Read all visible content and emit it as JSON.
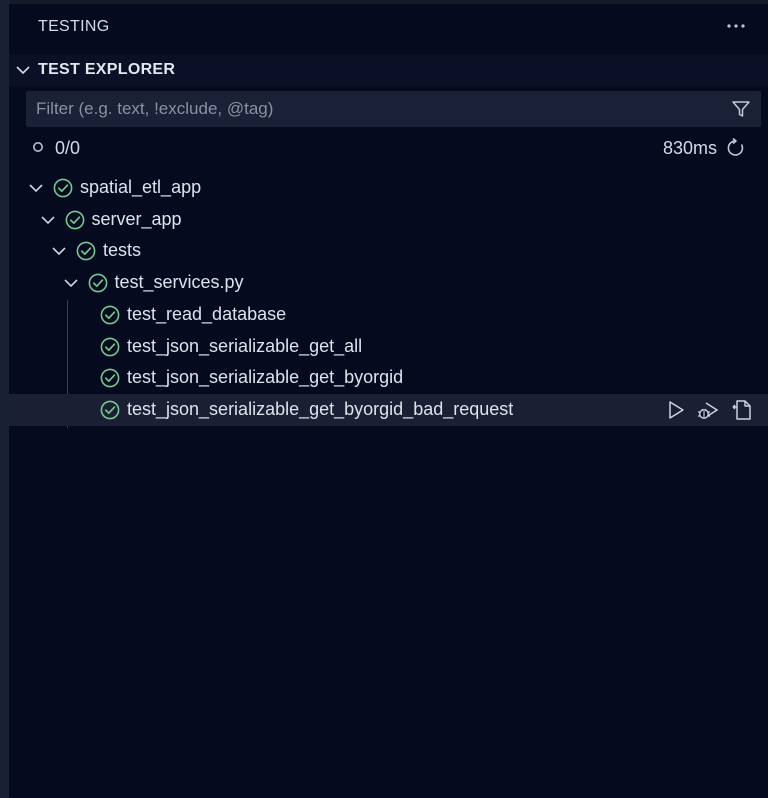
{
  "panel": {
    "title": "TESTING",
    "more_icon": "ellipsis-icon"
  },
  "section": {
    "title": "TEST EXPLORER",
    "expanded": true
  },
  "filter": {
    "value": "",
    "placeholder": "Filter (e.g. text, !exclude, @tag)",
    "icon": "filter-icon"
  },
  "summary": {
    "count": "0/0",
    "duration": "830ms",
    "status_icon": "circle-icon",
    "rerun_icon": "refresh-icon"
  },
  "tree": {
    "items": [
      {
        "label": "spatial_etl_app",
        "status": "passed",
        "expanded": true,
        "depth": 0
      },
      {
        "label": "server_app",
        "status": "passed",
        "expanded": true,
        "depth": 1
      },
      {
        "label": "tests",
        "status": "passed",
        "expanded": true,
        "depth": 2
      },
      {
        "label": "test_services.py",
        "status": "passed",
        "expanded": true,
        "depth": 3
      },
      {
        "label": "test_read_database",
        "status": "passed",
        "depth": 4
      },
      {
        "label": "test_json_serializable_get_all",
        "status": "passed",
        "depth": 4
      },
      {
        "label": "test_json_serializable_get_byorgid",
        "status": "passed",
        "depth": 4
      },
      {
        "label": "test_json_serializable_get_byorgid_bad_request",
        "status": "passed",
        "depth": 4,
        "selected": true
      }
    ],
    "row_actions": [
      "run-test-icon",
      "debug-test-icon",
      "go-to-test-icon"
    ]
  },
  "colors": {
    "background": "#050a1f",
    "passed": "#73c991",
    "text": "#dfe2ec",
    "selected_row": "#1a1f33"
  }
}
